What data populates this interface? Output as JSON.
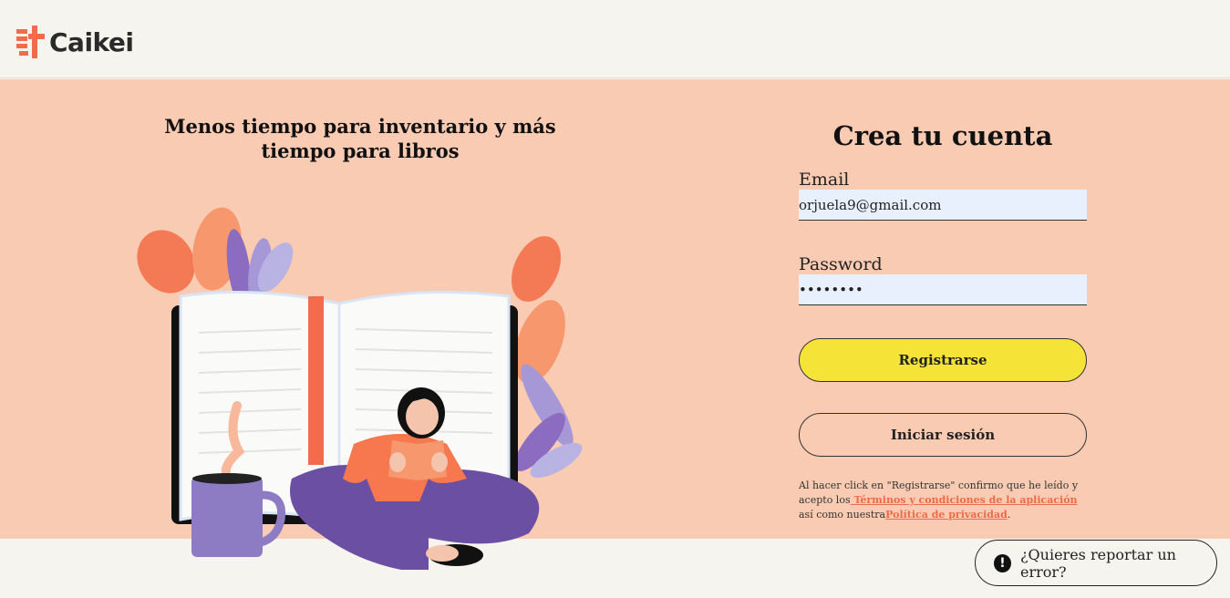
{
  "header": {
    "logo_text": "Caikei"
  },
  "hero": {
    "title": "Menos tiempo para inventario y más tiempo para libros"
  },
  "signup_form": {
    "title": "Crea tu cuenta",
    "email_label": "Email",
    "email_value": "orjuela9@gmail.com",
    "password_label": "Password",
    "password_value": "12345678",
    "register_button": "Registrarse",
    "login_button": "Iniciar sesión",
    "legal_prefix": "Al hacer click en \"Registrarse\" confirmo que he leído y acepto los",
    "terms_link": " Términos y condiciones de la aplicación ",
    "legal_middle": "así como nuestra",
    "privacy_link": "Política de privacidad",
    "legal_suffix": "."
  },
  "report_button": {
    "icon": "exclamation-circle-icon",
    "label": "¿Quieres reportar un error?"
  },
  "colors": {
    "brand": "#f26b4b",
    "hero_background": "#f8cbb2",
    "page_background": "#f6f4ee",
    "primary_button": "#f5e337",
    "input_background": "#e8f0fe"
  }
}
